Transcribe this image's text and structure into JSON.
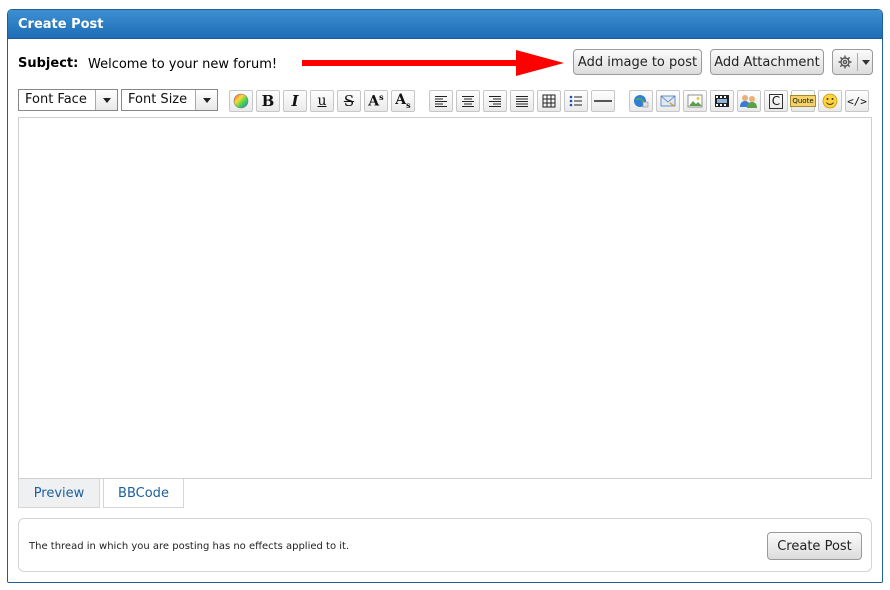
{
  "header": {
    "title": "Create Post"
  },
  "subject": {
    "label": "Subject:",
    "value": "Welcome to your new forum!"
  },
  "annotation": {
    "arrow_color": "#ff0000"
  },
  "buttons": {
    "add_image": "Add image to post",
    "add_attachment": "Add Attachment",
    "create_post": "Create Post"
  },
  "toolbar": {
    "font_face": "Font Face",
    "font_size": "Font Size",
    "tools": [
      "color-icon",
      "bold-icon",
      "italic-icon",
      "underline-icon",
      "strikethrough-icon",
      "superscript-icon",
      "subscript-icon",
      "align-left-icon",
      "align-center-icon",
      "align-right-icon",
      "justify-icon",
      "table-icon",
      "bullet-list-icon",
      "horizontal-rule-icon",
      "link-icon",
      "email-icon",
      "image-icon",
      "video-icon",
      "user-mention-icon",
      "code-icon",
      "quote-icon",
      "smiley-icon",
      "source-icon"
    ],
    "bold_glyph": "B",
    "italic_glyph": "I",
    "underline_glyph": "u",
    "strike_glyph": "S",
    "super_glyph": "A",
    "super_mark": "s",
    "sub_glyph": "A",
    "sub_mark": "s",
    "code_glyph": "C",
    "quote_glyph": "Quote",
    "source_glyph": "</>"
  },
  "tabs": [
    {
      "label": "Preview"
    },
    {
      "label": "BBCode"
    }
  ],
  "footer": {
    "note": "The thread in which you are posting has no effects applied to it."
  },
  "colors": {
    "header_start": "#3d8fd1",
    "header_end": "#1e6db7",
    "tab_text": "#1c5f9c"
  }
}
